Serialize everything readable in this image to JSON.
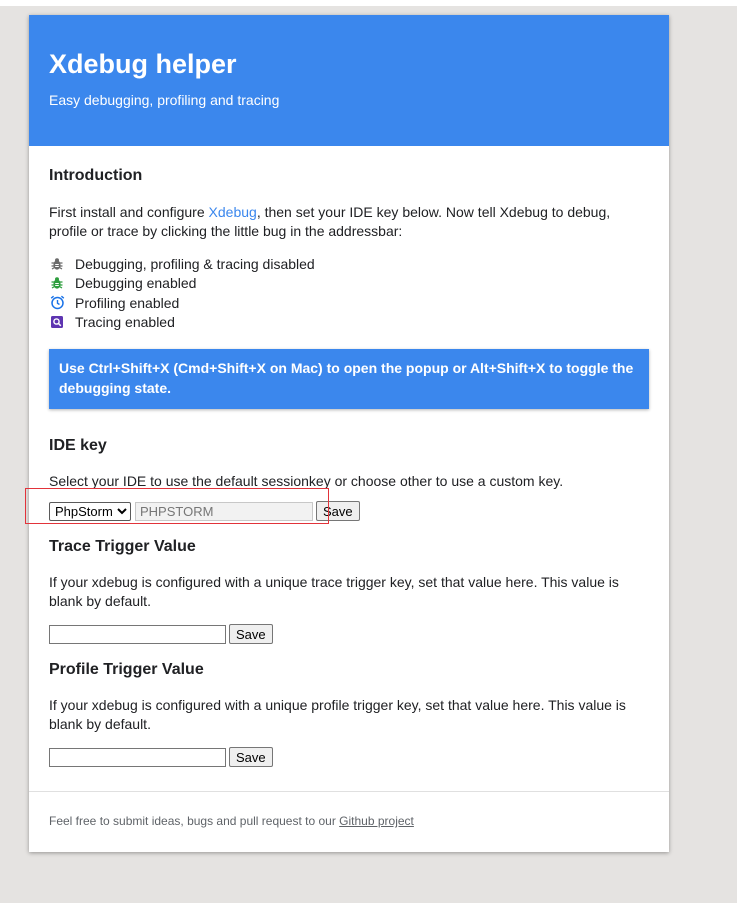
{
  "header": {
    "title": "Xdebug helper",
    "subtitle": "Easy debugging, profiling and tracing"
  },
  "intro": {
    "title": "Introduction",
    "text_before_link": "First install and configure ",
    "link_text": "Xdebug",
    "text_after_link": ", then set your IDE key below. Now tell Xdebug to debug, profile or trace by clicking the little bug in the addressbar:",
    "states": [
      {
        "icon": "bug-gray-icon",
        "label": "Debugging, profiling & tracing disabled"
      },
      {
        "icon": "bug-green-icon",
        "label": "Debugging enabled"
      },
      {
        "icon": "clock-icon",
        "label": "Profiling enabled"
      },
      {
        "icon": "magnifier-purple-icon",
        "label": "Tracing enabled"
      }
    ],
    "notice": "Use Ctrl+Shift+X (Cmd+Shift+X on Mac) to open the popup or Alt+Shift+X to toggle the debugging state."
  },
  "ide": {
    "title": "IDE key",
    "description": "Select your IDE to use the default sessionkey or choose other to use a custom key.",
    "selected_ide": "PhpStorm",
    "key_value": "PHPSTORM",
    "save_label": "Save"
  },
  "trace": {
    "title": "Trace Trigger Value",
    "description": "If your xdebug is configured with a unique trace trigger key, set that value here. This value is blank by default.",
    "value": "",
    "save_label": "Save"
  },
  "profile": {
    "title": "Profile Trigger Value",
    "description": "If your xdebug is configured with a unique profile trigger key, set that value here. This value is blank by default.",
    "value": "",
    "save_label": "Save"
  },
  "footer": {
    "text": "Feel free to submit ideas, bugs and pull request to our ",
    "link_text": "Github project"
  },
  "colors": {
    "accent": "#3b87ed",
    "highlight_box": "#e2333a",
    "page_background": "#e5e3e1"
  }
}
